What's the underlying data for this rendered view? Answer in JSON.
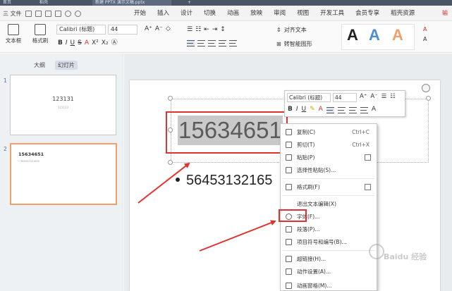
{
  "titlebar": {
    "tabs": [
      "首页",
      "稻壳",
      "新建 PPTX 演示文稿.pptx",
      "+"
    ]
  },
  "menubar": {
    "file_label": "三 文件",
    "tabs": [
      "开始",
      "插入",
      "设计",
      "切换",
      "动画",
      "放映",
      "审阅",
      "视图",
      "开发工具",
      "会员专享",
      "稻壳资源"
    ],
    "right_label": "输"
  },
  "ribbon": {
    "textbox_label": "文本框",
    "format_painter_label": "格式刷",
    "font_name": "Calibri (标题)",
    "font_size": "44",
    "align_text_label": "对齐文本",
    "convert_smartart_label": "转智能图形"
  },
  "left_pane": {
    "tabs": [
      "大纲",
      "幻灯片"
    ],
    "slides": [
      {
        "number": "1",
        "title": "123131",
        "subtitle": "123123"
      },
      {
        "number": "2",
        "title": "15634651",
        "subtitle": "• 564531321653"
      }
    ]
  },
  "slide": {
    "title_text": "15634651",
    "bullet_text": "56453132165"
  },
  "mini_toolbar": {
    "font_name": "Calibri (标题)",
    "font_size": "44"
  },
  "context_menu": {
    "items": [
      {
        "label": "复制(C)",
        "shortcut": "Ctrl+C"
      },
      {
        "label": "剪切(T)",
        "shortcut": "Ctrl+X"
      },
      {
        "label": "粘贴(P)",
        "shortcut": ""
      },
      {
        "label": "选择性粘贴(S)...",
        "shortcut": ""
      },
      {
        "label": "格式刷(F)",
        "shortcut": ""
      },
      {
        "label": "退出文本编辑(X)",
        "shortcut": ""
      },
      {
        "label": "字体(F)...",
        "shortcut": ""
      },
      {
        "label": "段落(P)...",
        "shortcut": ""
      },
      {
        "label": "项目符号和编号(B)...",
        "shortcut": ""
      },
      {
        "label": "超链接(H)...",
        "shortcut": ""
      },
      {
        "label": "动作设置(A)...",
        "shortcut": ""
      },
      {
        "label": "动画窗格(M)...",
        "shortcut": ""
      }
    ]
  },
  "watermark": "Baidu 经验",
  "colors": {
    "accent_red": "#e0332f",
    "menu_active_red": "#d0302d",
    "slide_selected_border": "#f0a068"
  }
}
